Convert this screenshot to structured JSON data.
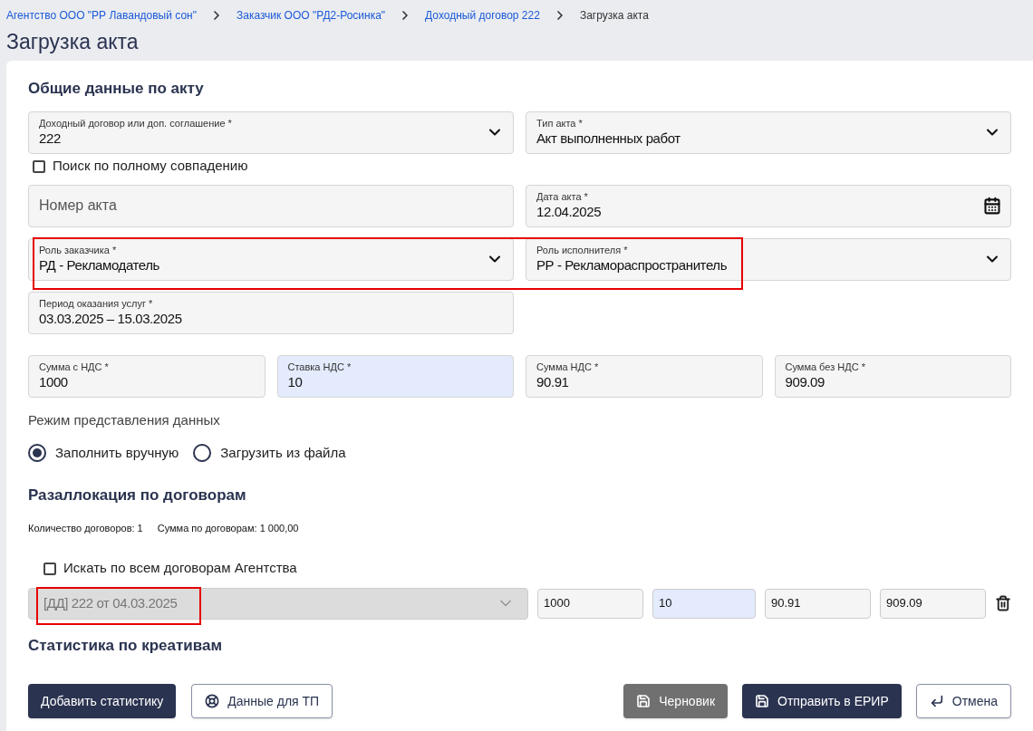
{
  "breadcrumbs": [
    {
      "label": "Агентство ООО \"РР Лавандовый сон\"",
      "current": false
    },
    {
      "label": "Заказчик ООО \"РД2-Росинка\"",
      "current": false
    },
    {
      "label": "Доходный договор 222",
      "current": false
    },
    {
      "label": "Загрузка акта",
      "current": true
    }
  ],
  "title": "Загрузка акта",
  "general": {
    "title": "Общие данные по акту",
    "contract": {
      "label": "Доходный договор или доп. соглашение *",
      "value": "222"
    },
    "act_type": {
      "label": "Тип акта *",
      "value": "Акт выполненных работ"
    },
    "exact_match": {
      "label": "Поиск по полному совпадению",
      "checked": false
    },
    "act_number": {
      "placeholder": "Номер акта"
    },
    "act_date": {
      "label": "Дата акта *",
      "value": "12.04.2025"
    },
    "customer_role": {
      "label": "Роль заказчика *",
      "value": "РД - Рекламодатель"
    },
    "executor_role": {
      "label": "Роль исполнителя *",
      "value": "РР - Рекламораспространитель"
    },
    "period": {
      "label": "Период оказания услуг *",
      "value": "03.03.2025 – 15.03.2025"
    },
    "amounts": [
      {
        "label": "Сумма с НДС *",
        "value": "1000",
        "focused": false
      },
      {
        "label": "Ставка НДС *",
        "value": "10",
        "focused": true
      },
      {
        "label": "Сумма НДС *",
        "value": "90.91",
        "focused": false
      },
      {
        "label": "Сумма без НДС *",
        "value": "909.09",
        "focused": false
      }
    ]
  },
  "data_mode": {
    "label": "Режим представления данных",
    "options": [
      {
        "label": "Заполнить вручную",
        "selected": true
      },
      {
        "label": "Загрузить из файла",
        "selected": false
      }
    ]
  },
  "reallocation": {
    "title": "Разаллокация по договорам",
    "summary": [
      "Количество договоров: 1",
      "Сумма по договорам: 1 000,00"
    ],
    "search_all": {
      "label": "Искать по всем договорам Агентства",
      "checked": false
    },
    "rows": [
      {
        "contract": "[ДД] 222 от 04.03.2025",
        "disabled": true,
        "amounts": [
          {
            "value": "1000",
            "focused": false
          },
          {
            "value": "10",
            "focused": true
          },
          {
            "value": "90.91",
            "focused": false
          },
          {
            "value": "909.09",
            "focused": false
          }
        ]
      }
    ]
  },
  "statistics": {
    "title": "Статистика по креативам"
  },
  "buttons_left": [
    {
      "label": "Добавить статистику",
      "kind": "primary"
    },
    {
      "label": "Данные для ТП",
      "kind": "help"
    }
  ],
  "buttons_right": [
    {
      "label": "Черновик",
      "kind": "draft"
    },
    {
      "label": "Отправить в ЕРИР",
      "kind": "submit"
    },
    {
      "label": "Отмена",
      "kind": "cancel"
    }
  ]
}
